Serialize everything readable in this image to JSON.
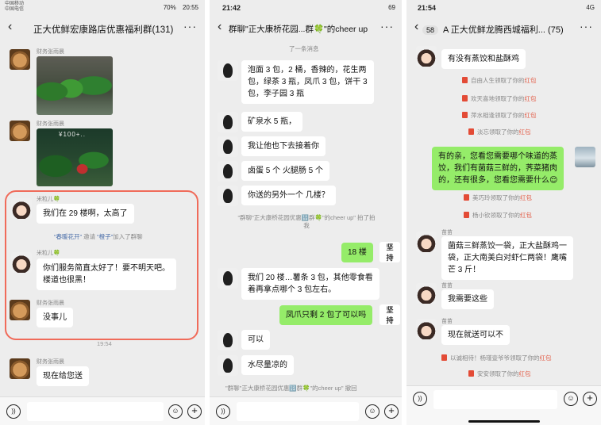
{
  "panel1": {
    "status": {
      "carrier1": "中国移动",
      "carrier2": "中国电信",
      "battery": "70%",
      "time": "20:55"
    },
    "title": "正大优鲜宏康路店优惠福利群(131)",
    "messages": [
      {
        "sender": "财务张雨晨",
        "type": "image"
      },
      {
        "sender": "财务张雨晨",
        "type": "image",
        "overlay_text": "¥100+.."
      },
      {
        "sender": "米粒儿🍀",
        "text": "我们在 29 楼啊，太高了"
      },
      {
        "invite_from": "“春暖花开”",
        "invite_mid": " 邀请 ",
        "invite_to": "“橙子”",
        "invite_end": "加入了群聊"
      },
      {
        "sender": "米粒儿🍀",
        "text_line1": "你们服务简直太好了！要不明天吧。",
        "text_line2": "楼道也很黑！"
      },
      {
        "sender": "财务张雨晨",
        "text": "没事儿"
      },
      {
        "timestamp": "19:54"
      },
      {
        "sender": "财务张雨晨",
        "text": "现在给您送"
      }
    ]
  },
  "panel2": {
    "status": {
      "time": "21:42",
      "battery": "69"
    },
    "title_left": "群聊\"正大康桥花园...",
    "title_right": "群🍀\"的cheer up",
    "messages": [
      {
        "note": "了一条消息"
      },
      {
        "text_line1": "泡面 3 包，2 桶，香辣的，花生两",
        "text_line2": "包，绿茶 3 瓶，凤爪 3 包，饼干 3",
        "text_line3": "包，李子园 3 瓶"
      },
      {
        "text": "矿泉水 5 瓶，"
      },
      {
        "text": "我让他也下去接着你"
      },
      {
        "text": "卤蛋 5 个 火腿肠 5 个"
      },
      {
        "text": "你送的另外一个 几楼？"
      },
      {
        "note_line1": "\"群聊\"正大康桥花园优惠🔢群🍀\"的cheer up\" 拍了拍",
        "note_line2": "我"
      },
      {
        "text": "18 楼",
        "own": true
      },
      {
        "text_line1": "我们 20 楼…薯条 3 包，其他零食看",
        "text_line2": "着再拿点哪个 3 包左右。"
      },
      {
        "text": "凤爪只剩 2 包了可以吗",
        "own": true
      },
      {
        "text": "可以"
      },
      {
        "text": "水尽量凉的"
      },
      {
        "note": "\"群聊\"正大康桥花园优惠🔢群🍀\"的cheer up\" 撤回"
      }
    ],
    "logo_text_top": "坚",
    "logo_text_bottom": "持"
  },
  "panel3": {
    "status": {
      "time": "21:54",
      "network": "4G"
    },
    "unread": "58",
    "title": "A 正大优鲜龙腾西城福利...",
    "member_count": "(75)",
    "messages": [
      {
        "text": "有没有蒸饺和盐酥鸡"
      },
      {
        "who": "自由人生",
        "action": "领取了你的",
        "what": "红包"
      },
      {
        "who": "欢天喜地",
        "action": "领取了你的",
        "what": "红包"
      },
      {
        "who": "萍水相逢",
        "action": "领取了你的",
        "what": "红包"
      },
      {
        "who": "淡忘",
        "action": "领取了你的",
        "what": "红包"
      },
      {
        "own": true,
        "text_line1": "有的亲，您看您需要哪个味道的蒸",
        "text_line2": "饺，我们有菌菇三鲜的，荠菜猪肉",
        "text_line3": "的，还有很多，您看您需要什么😌"
      },
      {
        "who": "美巧玲",
        "action": "领取了你的",
        "what": "红包"
      },
      {
        "who": "杨小钦",
        "action": "领取了你的",
        "what": "红包"
      },
      {
        "sender": "苗苗",
        "text_line1": "菌菇三鲜蒸饺一袋，正大盐酥鸡一",
        "text_line2": "袋，正大南美白对虾仁两袋！鹰嘴",
        "text_line3": "芒 3 斤！"
      },
      {
        "sender": "苗苗",
        "text": "我需要这些"
      },
      {
        "sender": "苗苗",
        "text": "现在就送可以不"
      },
      {
        "who": "以诚相待！杨瑾壹爷爷",
        "action": "领取了你的",
        "what": "红包"
      },
      {
        "who": "安安",
        "action": "领取了你的",
        "what": "红包"
      }
    ]
  },
  "icons": {
    "back": "‹",
    "more": "···",
    "voice": "))",
    "emoji": "☺",
    "plus": "+"
  }
}
